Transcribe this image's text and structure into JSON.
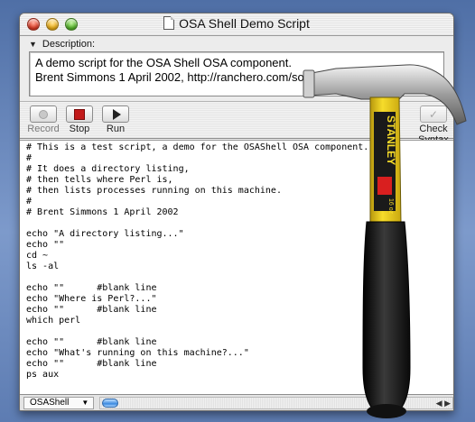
{
  "window": {
    "title": "OSA Shell Demo Script"
  },
  "description": {
    "label": "Description:",
    "line1": "A demo script for the OSA Shell OSA component.",
    "line2": "Brent Simmons 1 April 2002, http://ranchero.com/software/osashell/"
  },
  "toolbar": {
    "record_label": "Record",
    "stop_label": "Stop",
    "run_label": "Run",
    "check_label": "Check Syntax"
  },
  "script": {
    "lines": [
      "# This is a test script, a demo for the OSAShell OSA component.",
      "#",
      "# It does a directory listing,",
      "# then tells where Perl is,",
      "# then lists processes running on this machine.",
      "#",
      "# Brent Simmons 1 April 2002",
      "",
      "echo \"A directory listing...\"",
      "echo \"\"",
      "cd ~",
      "ls -al",
      "",
      "echo \"\"      #blank line",
      "echo \"Where is Perl?...\"",
      "echo \"\"      #blank line",
      "which perl",
      "",
      "echo \"\"      #blank line",
      "echo \"What's running on this machine?...\"",
      "echo \"\"      #blank line",
      "ps aux"
    ]
  },
  "status": {
    "language": "OSAShell"
  },
  "overlay": {
    "hammer_brand": "STANLEY",
    "hammer_model": "16 oz"
  },
  "colors": {
    "desktop": "#6b88b8",
    "stop_red": "#c21a1a",
    "hammer_yellow": "#f2d21a",
    "hammer_black": "#1b1b1b"
  }
}
